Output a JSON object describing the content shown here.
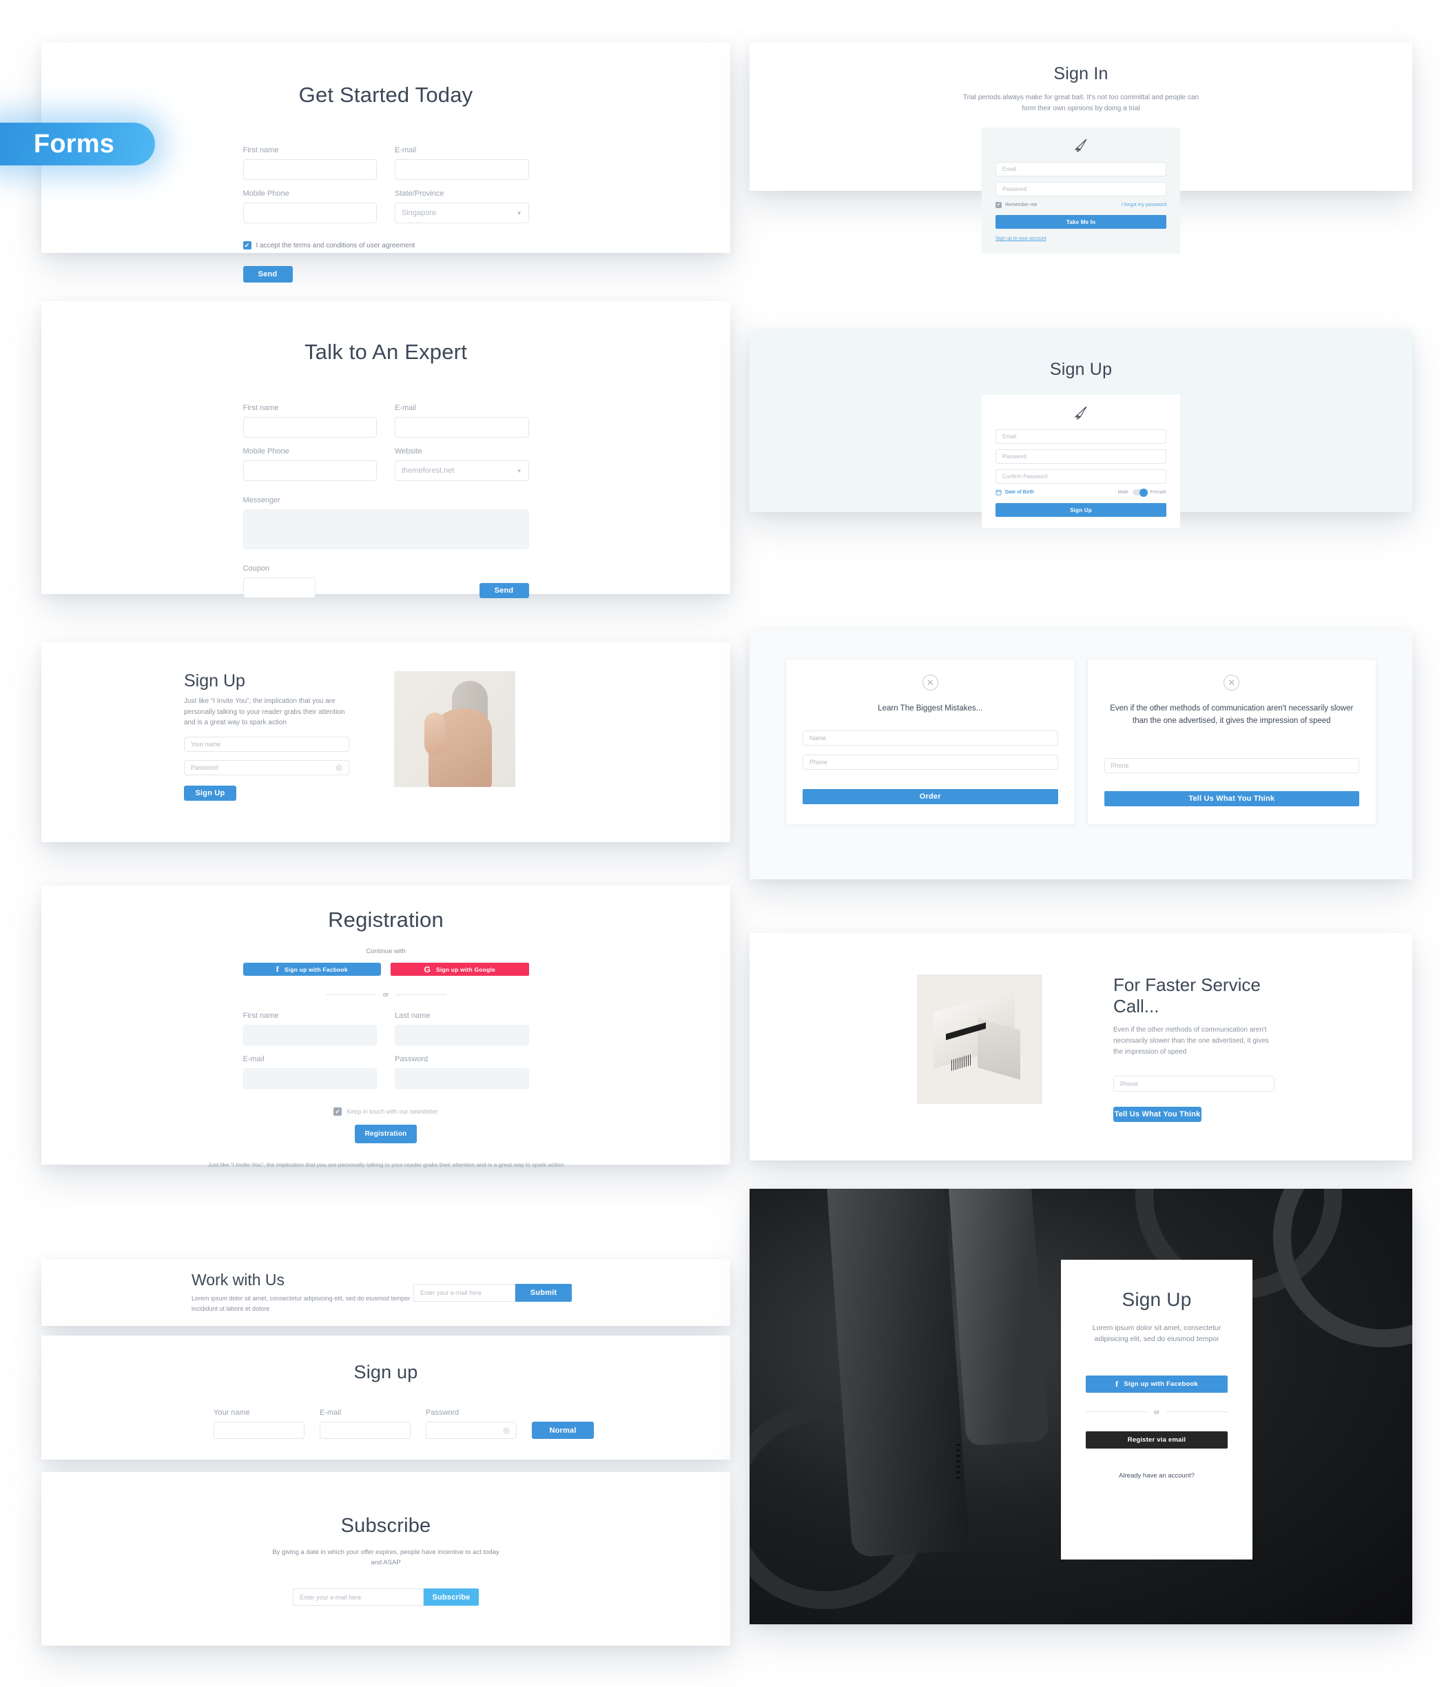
{
  "badge": {
    "label": "Forms"
  },
  "colors": {
    "primary": "#3f95db",
    "light_blue": "#4db8ee",
    "red": "#f4325b",
    "dark": "#262626",
    "tint": "#f1f7f8"
  },
  "get_started": {
    "title": "Get Started Today",
    "fields": [
      {
        "label": "First name",
        "value": ""
      },
      {
        "label": "E-mail",
        "value": ""
      },
      {
        "label": "Mobile Phone",
        "value": ""
      },
      {
        "label": "State/Province",
        "value": "Singapore"
      }
    ],
    "terms_label": "I accept the terms and conditions of user agreement",
    "submit_label": "Send"
  },
  "sign_in": {
    "title": "Sign In",
    "subtitle": "Trial periods always make for great bait. It's not too committal and people can form their own opinions by doing a trial",
    "email_placeholder": "Email",
    "password_placeholder": "Password",
    "remember_label": "Remember me",
    "forgot_label": "I forgot my password",
    "submit_label": "Take Me In",
    "signup_link": "Sign up to your account"
  },
  "talk_expert": {
    "title": "Talk to An Expert",
    "fields": [
      {
        "label": "First name",
        "value": ""
      },
      {
        "label": "E-mail",
        "value": ""
      },
      {
        "label": "Mobile Phone",
        "value": ""
      },
      {
        "label": "Website",
        "value": "themeforest.net"
      }
    ],
    "messenger_label": "Messenger",
    "coupon_label": "Coupon",
    "submit_label": "Send"
  },
  "sign_up_tinted": {
    "title": "Sign Up",
    "email_placeholder": "Email",
    "password_placeholder": "Password",
    "confirm_placeholder": "Confirm Password",
    "dob_label": "Date of Birth",
    "male_label": "Male",
    "female_label": "Female",
    "submit_label": "Sign Up"
  },
  "sign_up_image": {
    "title": "Sign Up",
    "description": "Just like “I Invite You”, the implication that you are personally talking to your reader grabs their attention and is a great way to spark action",
    "name_placeholder": "Your name",
    "password_placeholder": "Password",
    "submit_label": "Sign Up"
  },
  "two_cards": {
    "card_a": {
      "title": "Learn The Biggest Mistakes...",
      "name_placeholder": "Name",
      "phone_placeholder": "Phone",
      "submit_label": "Order"
    },
    "card_b": {
      "title": "Even if the other methods of communication aren't necessarily slower than the one advertised, it gives the impression of speed",
      "phone_placeholder": "Phone",
      "submit_label": "Tell Us What You Think"
    }
  },
  "registration": {
    "title": "Registration",
    "continue_with": "Continue with",
    "facebook_label": "Sign up with Facbook",
    "google_label": "Sign up with Google",
    "or_label": "or",
    "fields": [
      {
        "label": "First name",
        "value": ""
      },
      {
        "label": "Last name",
        "value": ""
      },
      {
        "label": "E-mail",
        "value": ""
      },
      {
        "label": "Password",
        "value": ""
      }
    ],
    "newsletter_label": "Keep in touch with our newsletter",
    "submit_label": "Registration",
    "footer": "Just like “I Invite You”, the implication that you are personally talking to your reader grabs their attention and is a great way to spark action"
  },
  "faster_service": {
    "title": "For Faster Service Call...",
    "description": "Even if the other methods of communication aren't necessarily slower than the one advertised, it gives the impression of speed",
    "phone_placeholder": "Phone",
    "submit_label": "Tell Us What You Think"
  },
  "work_with_us": {
    "title": "Work with Us",
    "description": "Lorem ipsum dolor sit amet, consectetur adipisicing elit, sed do eiusmod tempor incididunt ut labore et dolore",
    "email_placeholder": "Enter your e-mail here",
    "submit_label": "Submit"
  },
  "sign_up_inline": {
    "title": "Sign up",
    "fields": [
      {
        "label": "Your name",
        "value": ""
      },
      {
        "label": "E-mail",
        "value": ""
      },
      {
        "label": "Password",
        "value": ""
      }
    ],
    "submit_label": "Normal"
  },
  "subscribe": {
    "title": "Subscribe",
    "subtitle": "By giving a date in which your offer expires, people have incentive to act today and ASAP",
    "email_placeholder": "Enter your e-mail here",
    "submit_label": "Subscribe"
  },
  "sign_up_dark": {
    "title": "Sign Up",
    "subtitle": "Lorem ipsum dolor sit amet, consectetur adipisicing elit, sed do eiusmod tempor",
    "facebook_label": "Sign up with Facebook",
    "or_label": "or",
    "email_label": "Register via email",
    "account_label": "Already have an account?"
  }
}
